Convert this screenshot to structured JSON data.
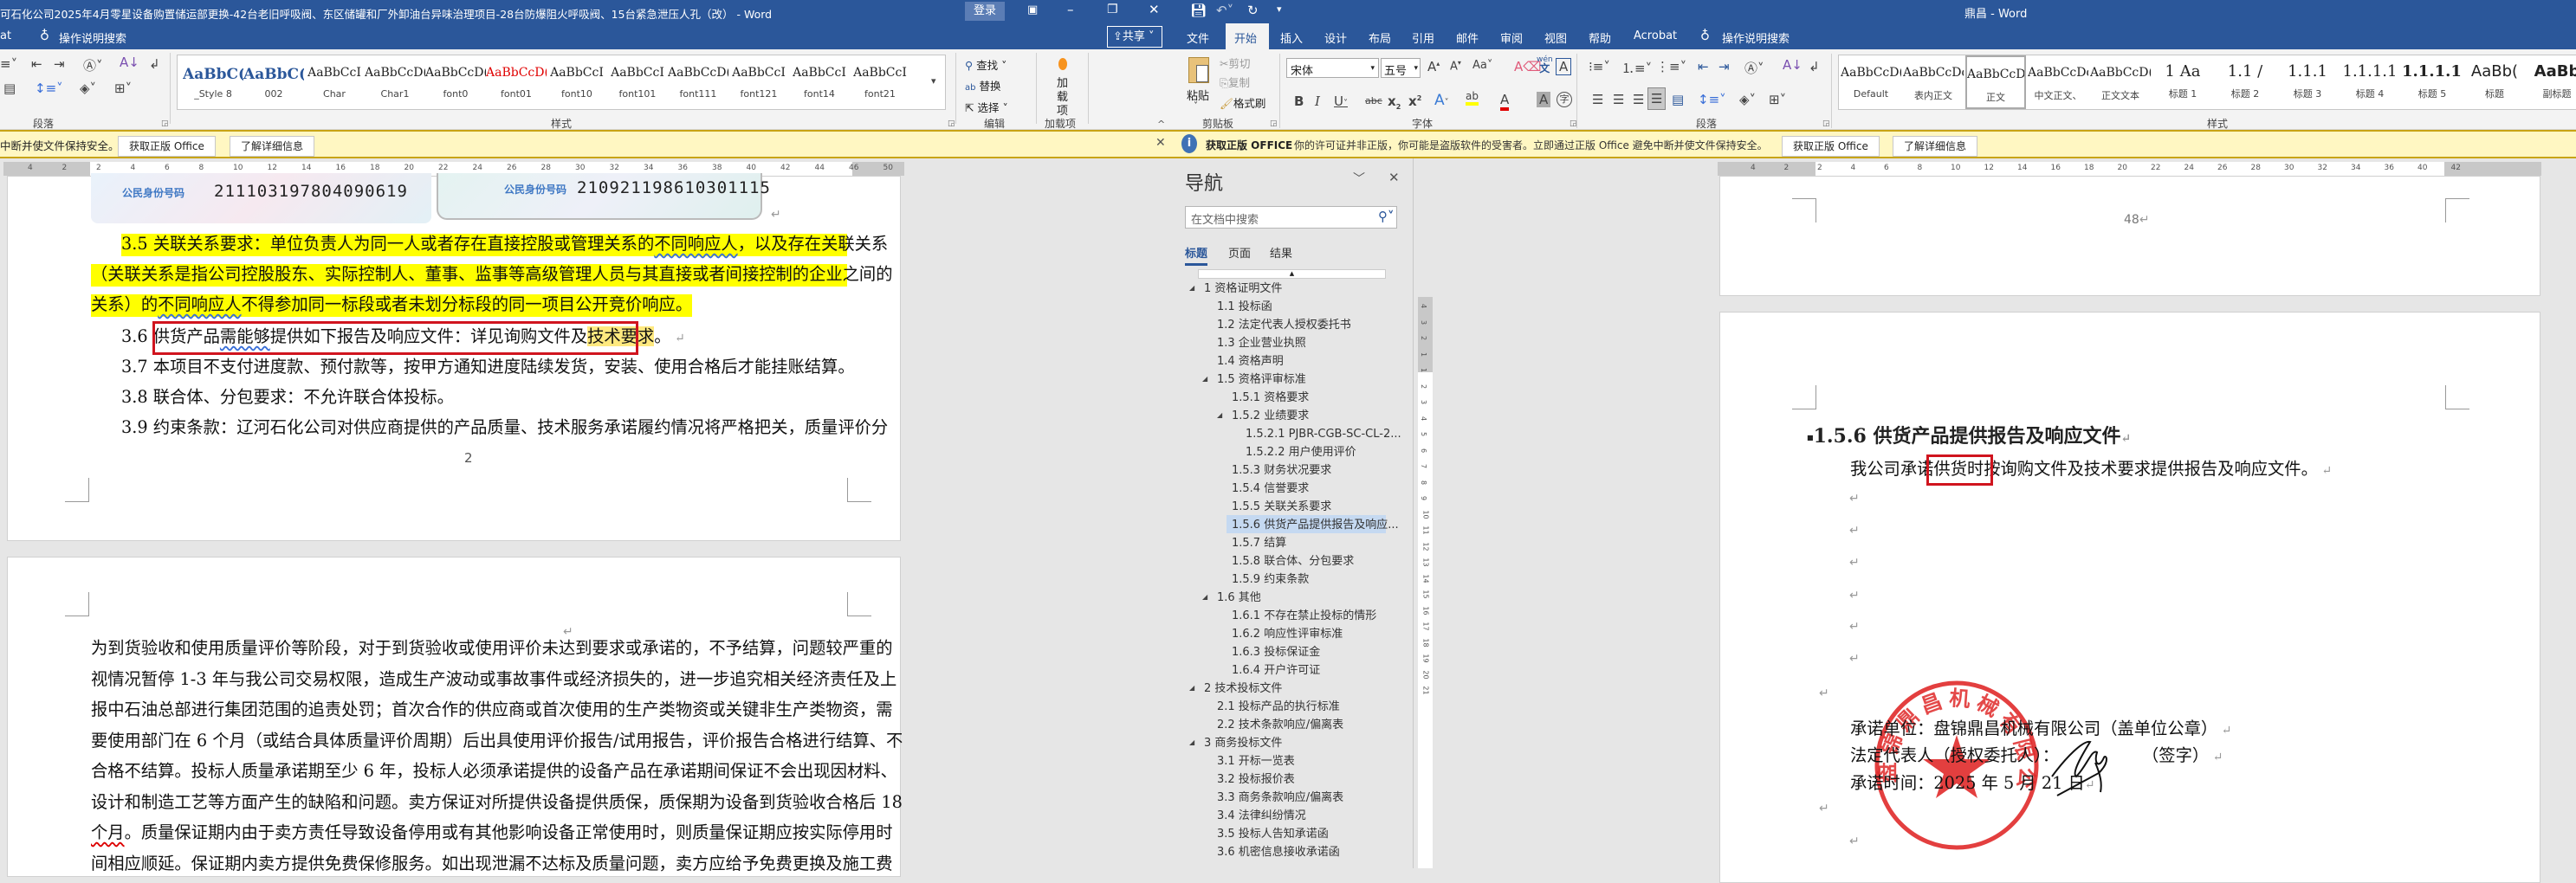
{
  "left_window": {
    "title": "可石化公司2025年4月零星设备购置储运部更换-42台老旧呼吸阀、东区储罐和厂外卸油台异味治理项目-28台防爆阻火呼吸阀、15台紧急泄压人孔（改） - Word",
    "signin": "登录",
    "tab_partial": "at",
    "tell_me": "操作说明搜索",
    "share": "共享",
    "groups": {
      "paragraph": "段落",
      "styles": "样式",
      "editing": "编辑",
      "addins": "加载项"
    },
    "editing": {
      "find": "查找",
      "replace": "替换",
      "select": "选择"
    },
    "addins_button": "加载项",
    "styles": [
      {
        "preview": "AaBbC(",
        "name": "_Style 8"
      },
      {
        "preview": "AaBbC(",
        "name": "002"
      },
      {
        "preview": "AaBbCcI",
        "name": "Char"
      },
      {
        "preview": "AaBbCcD(",
        "name": "Char1"
      },
      {
        "preview": "AaBbCcD(",
        "name": "font0"
      },
      {
        "preview": "AaBbCcD(",
        "name": "font01"
      },
      {
        "preview": "AaBbCcI",
        "name": "font10"
      },
      {
        "preview": "AaBbCcI",
        "name": "font101"
      },
      {
        "preview": "AaBbCcD(",
        "name": "font111"
      },
      {
        "preview": "AaBbCcI",
        "name": "font121"
      },
      {
        "preview": "AaBbCcI",
        "name": "font14"
      },
      {
        "preview": "AaBbCcI",
        "name": "font21"
      }
    ],
    "infobar": {
      "message": "中断并使文件保持安全。",
      "btn_get": "获取正版 Office",
      "btn_learn": "了解详细信息"
    },
    "ruler_labels": [
      "4",
      "2",
      "2",
      "4",
      "6",
      "8",
      "10",
      "12",
      "14",
      "16",
      "18",
      "20",
      "22",
      "24",
      "26",
      "28",
      "30",
      "32",
      "34",
      "36",
      "38",
      "40",
      "42",
      "44",
      "46",
      "50"
    ],
    "doc": {
      "id_cards": [
        {
          "label": "公民身份号码",
          "number": "211103197804090619"
        },
        {
          "label": "公民身份号码",
          "number": "210921198610301115"
        }
      ],
      "p35": [
        "3.5 关联关系要求：单位负责人为同一人或者存在直接控股或管理关系的",
        "不同响应人",
        "，以及存在关联关系",
        "（关联关系是指公司控股股东、实际控制人、董事、监事等高级管理人员与其直接或者间接控制的企业之间的",
        "关系）的",
        "不同响应人",
        "不得参加同一标段或者未划分标段的同一项目公开竞价响应。"
      ],
      "p36": {
        "num": "3.6 ",
        "a": "供货产品",
        "b": "需能够",
        "c": "提供如下报告及响应文件：详见询购文件及",
        "d": "技术要求",
        "e": "。"
      },
      "p37": "3.7 本项目不支付进度款、预付款等，按甲方通知进度陆续发货，安装、使用合格后才能挂账结算。",
      "p38": "3.8 联合体、分包要求：不允许联合体投标。",
      "p39": "3.9 约束条款：辽河石化公司对供应商提供的产品质量、技术服务承诺履约情况将严格把关，质量评价分",
      "page_number": "2",
      "page2_lines": [
        "为到货验收和使用质量评价等阶段，对于到货验收或使用评价未达到要求或承诺的，不予结算，问题较严重的",
        "视情况暂停 1-3 年与我公司交易权限，造成生产波动或事故事件或经济损失的，进一步追究相关经济责任及上",
        "报中石油总部进行集团范围的追责处罚；首次合作的供应商或首次使用的生产类物资或关键非生产类物资，需",
        "要使用部门在 6 个月（或结合具体质量评价周期）后出具使用评价报告/试用报告，评价报告合格进行结算、不",
        "合格不结算。投标人质量承诺期至少 6 年，投标人必须承诺提供的设备产品在承诺期间保证不会出现因材料、",
        "设计和制造工艺等方面产生的缺陷和问题。卖方保证对所提供设备提供质保，质保期为设备到货验收合格后 18",
        "个月。质量保证期内由于卖方责任导致设备停用或有其他影响设备正常使用时，则质量保证期应按实际停用时",
        "间相应顺延。保证期内卖方提供免费保修服务。如出现泄漏不达标及质量问题，卖方应给予免费更换及施工费"
      ]
    }
  },
  "right_window": {
    "title": "鼎昌 - Word",
    "tabs": [
      "文件",
      "开始",
      "插入",
      "设计",
      "布局",
      "引用",
      "邮件",
      "审阅",
      "视图",
      "帮助",
      "Acrobat"
    ],
    "active_tab": "开始",
    "tell_me": "操作说明搜索",
    "clipboard": {
      "paste": "粘贴",
      "cut": "剪切",
      "copy": "复制",
      "format_painter": "格式刷"
    },
    "font": {
      "name": "宋体",
      "size": "五号"
    },
    "groups": {
      "clipboard": "剪贴板",
      "font": "字体",
      "paragraph": "段落",
      "styles": "样式"
    },
    "styles": [
      {
        "preview": "AaBbCcD(",
        "name": "Default"
      },
      {
        "preview": "AaBbCcDdI",
        "name": "表内正文"
      },
      {
        "preview": "AaBbCcD",
        "name": "正文",
        "selected": true
      },
      {
        "preview": "AaBbCcDd",
        "name": "中文正文、"
      },
      {
        "preview": "AaBbCcD(",
        "name": "正文文本"
      },
      {
        "preview": "1  Aa",
        "name": "标题 1"
      },
      {
        "preview": "1.1 /",
        "name": "标题 2"
      },
      {
        "preview": "1.1.1",
        "name": "标题 3"
      },
      {
        "preview": "1.1.1.1",
        "name": "标题 4"
      },
      {
        "preview": "1.1.1.1.",
        "name": "标题 5"
      },
      {
        "preview": "AaBb(",
        "name": "标题"
      },
      {
        "preview": "AaBb",
        "name": "副标题"
      }
    ],
    "infobar": {
      "title": "获取正版 OFFICE",
      "message": "你的许可证并非正版，你可能是盗版软件的受害者。立即通过正版 Office 避免中断并使文件保持安全。",
      "btn_get": "获取正版 Office",
      "btn_learn": "了解详细信息"
    },
    "nav": {
      "title": "导航",
      "search_placeholder": "在文档中搜索",
      "tabs": [
        "标题",
        "页面",
        "结果"
      ],
      "active_tab": "标题",
      "items": [
        {
          "text": "1 资格证明文件",
          "level": 1,
          "expanded": true
        },
        {
          "text": "1.1 投标函",
          "level": 2
        },
        {
          "text": "1.2 法定代表人授权委托书",
          "level": 2
        },
        {
          "text": "1.3 企业营业执照",
          "level": 2
        },
        {
          "text": "1.4 资格声明",
          "level": 2
        },
        {
          "text": "1.5 资格评审标准",
          "level": 2,
          "expanded": true
        },
        {
          "text": "1.5.1 资格要求",
          "level": 3
        },
        {
          "text": "1.5.2 业绩要求",
          "level": 3,
          "expanded": true
        },
        {
          "text": "1.5.2.1 PJBR-CGB-SC-CL-2...",
          "level": 4
        },
        {
          "text": "1.5.2.2 用户使用评价",
          "level": 4
        },
        {
          "text": "1.5.3 财务状况要求",
          "level": 3
        },
        {
          "text": "1.5.4 信誉要求",
          "level": 3
        },
        {
          "text": "1.5.5 关联关系要求",
          "level": 3
        },
        {
          "text": "1.5.6 供货产品提供报告及响应...",
          "level": 3,
          "selected": true
        },
        {
          "text": "1.5.7 结算",
          "level": 3
        },
        {
          "text": "1.5.8 联合体、分包要求",
          "level": 3
        },
        {
          "text": "1.5.9 约束条款",
          "level": 3
        },
        {
          "text": "1.6 其他",
          "level": 2,
          "expanded": true
        },
        {
          "text": "1.6.1 不存在禁止投标的情形",
          "level": 3
        },
        {
          "text": "1.6.2 响应性评审标准",
          "level": 3
        },
        {
          "text": "1.6.3 投标保证金",
          "level": 3
        },
        {
          "text": "1.6.4 开户许可证",
          "level": 3
        },
        {
          "text": "2 技术投标文件",
          "level": 1,
          "expanded": true
        },
        {
          "text": "2.1 投标产品的执行标准",
          "level": 2
        },
        {
          "text": "2.2 技术条款响应/偏离表",
          "level": 2
        },
        {
          "text": "3 商务投标文件",
          "level": 1,
          "expanded": true
        },
        {
          "text": "3.1 开标一览表",
          "level": 2
        },
        {
          "text": "3.2 投标报价表",
          "level": 2
        },
        {
          "text": "3.3 商务条款响应/偏离表",
          "level": 2
        },
        {
          "text": "3.4 法律纠纷情况",
          "level": 2
        },
        {
          "text": "3.5 投标人告知承诺函",
          "level": 2
        },
        {
          "text": "3.6 机密信息接收承诺函",
          "level": 2
        }
      ]
    },
    "ruler_labels": [
      "4",
      "2",
      "2",
      "4",
      "6",
      "8",
      "10",
      "12",
      "14",
      "16",
      "18",
      "20",
      "22",
      "24",
      "26",
      "28",
      "30",
      "32",
      "34",
      "36",
      "40",
      "42"
    ],
    "vruler_labels": [
      "4",
      "3",
      "2",
      "1",
      "1",
      "2",
      "3",
      "4",
      "5",
      "6",
      "7",
      "8",
      "9",
      "10",
      "11",
      "12",
      "13",
      "14",
      "15",
      "16",
      "17",
      "18",
      "19",
      "20",
      "21"
    ],
    "doc": {
      "prev_page_number": "48",
      "heading": "1.5.6 供货产品提供报告及响应文件",
      "body_a": "我公司承诺",
      "body_b": "供货时",
      "body_c": "按询购文件及技术要求提供报告及响应文件。",
      "sign_unit": "承诺单位：盘锦鼎昌机械有限公司（盖单位公章）",
      "sign_rep": "法定代表人（授权委托人）：",
      "sign_rep_suffix": "（签字）",
      "sign_date": "承诺时间：2025 年 5 月 21 日",
      "stamp_text": "盘锦鼎昌机械有限公司"
    }
  },
  "colors": {
    "word_blue": "#2b579a",
    "highlight": "#ffff00",
    "annotation_red": "#d0141e",
    "stamp_red": "#e02a2a"
  }
}
